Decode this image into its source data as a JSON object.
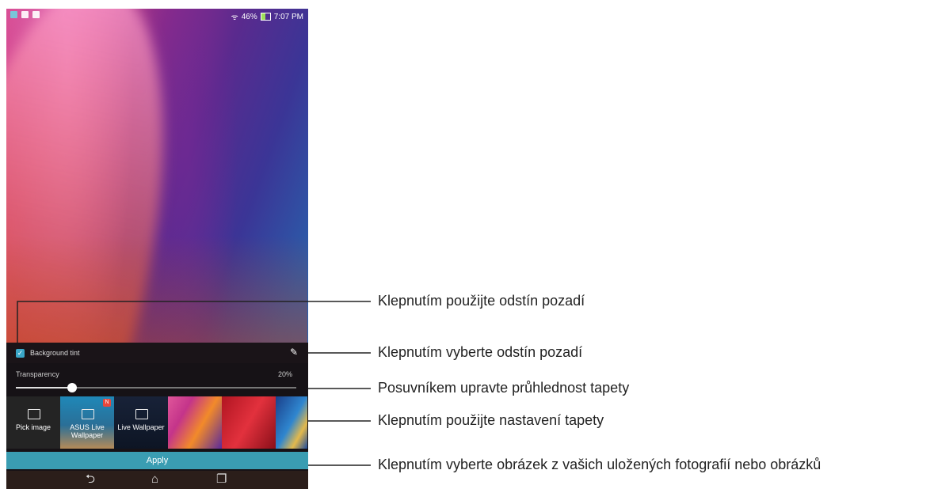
{
  "device": {
    "status": {
      "battery_percent_text": "46%",
      "battery_level": 0.46,
      "time": "7:07 PM",
      "wifi_icon": "wifi-icon"
    },
    "panel": {
      "background_tint_label": "Background tint",
      "background_tint_checked": true,
      "transparency_label": "Transparency",
      "transparency_value": "20%",
      "transparency_level": 0.2,
      "thumbnails": [
        {
          "label": "Pick image",
          "icon": "image-icon"
        },
        {
          "label": "ASUS Live Wallpaper",
          "badge": "N",
          "icon": "image-icon"
        },
        {
          "label": "Live Wallpaper",
          "icon": "image-icon"
        }
      ],
      "apply_label": "Apply"
    },
    "navbar": {
      "back_glyph": "⮌",
      "home_glyph": "⌂",
      "recents_glyph": "❐"
    }
  },
  "callouts": [
    "Klepnutím použijte odstín pozadí",
    "Klepnutím vyberte odstín pozadí",
    "Posuvníkem upravte průhlednost tapety",
    "Klepnutím použijte nastavení tapety",
    "Klepnutím vyberte obrázek z vašich uložených fotografií nebo obrázků"
  ]
}
